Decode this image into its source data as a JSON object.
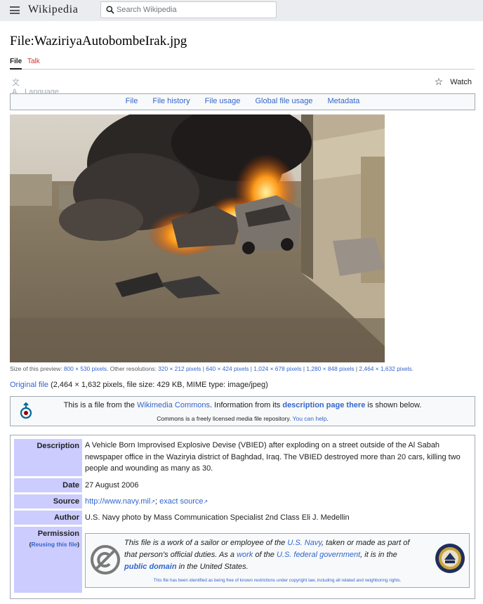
{
  "header": {
    "wordmark": "Wikipedia",
    "search_placeholder": "Search Wikipedia"
  },
  "page": {
    "title": "File:WaziriyaAutobombeIrak.jpg",
    "tabs": [
      {
        "label": "File",
        "active": true
      },
      {
        "label": "Talk",
        "active": false
      }
    ],
    "language_label": "Language",
    "watch_label": "Watch"
  },
  "filetoc": [
    "File",
    "File history",
    "File usage",
    "Global file usage",
    "Metadata"
  ],
  "preview": {
    "size_label": "Size of this preview:",
    "size_value": "800 × 530 pixels",
    "other_label": ". Other resolutions:",
    "resolutions": [
      "320 × 212 pixels",
      "640 × 424 pixels",
      "1,024 × 678 pixels",
      "1,280 × 848 pixels",
      "2,464 × 1,632 pixels"
    ],
    "end": "."
  },
  "original": {
    "link": "Original file",
    "details": " (2,464 × 1,632 pixels, file size: 429 KB, MIME type: image/jpeg)"
  },
  "commons": {
    "line1_a": "This is a file from the ",
    "line1_link": "Wikimedia Commons",
    "line1_b": ". Information from its ",
    "line1_bold_link": "description page there",
    "line1_c": " is shown below.",
    "line2_a": "Commons is a freely licensed media file repository. ",
    "line2_link": "You can help",
    "line2_b": "."
  },
  "info": {
    "description_label": "Description",
    "description_value": "A Vehicle Born Improvised Explosive Devise (VBIED) after exploding on a street outside of the Al Sabah newspaper office in the Waziryia district of Baghdad, Iraq. The VBIED destroyed more than 20 cars, killing two people and wounding as many as 30.",
    "date_label": "Date",
    "date_value": "27 August 2006",
    "source_label": "Source",
    "source_link1": "http://www.navy.mil",
    "source_sep": "; ",
    "source_link2": "exact source",
    "author_label": "Author",
    "author_value": "U.S. Navy photo by Mass Communication Specialist 2nd Class Eli J. Medellin",
    "permission_label": "Permission",
    "reuse_open": "(",
    "reuse_link": "Reusing this file",
    "reuse_close": ")"
  },
  "permission": {
    "t1": "This file is a work of a sailor or employee of the ",
    "l1": "U.S. Navy",
    "t2": ", taken or made as part of that person's official duties. As a ",
    "l2": "work",
    "t3": " of the ",
    "l3": "U.S. federal government",
    "t4": ", it is in the ",
    "l4": "public domain",
    "t5": " in the United States.",
    "note": "This file has been identified as being free of known restrictions under copyright law, including all related and neighboring rights."
  },
  "colors": {
    "link": "#3366cc",
    "header_bg": "#eaecf0",
    "label_bg": "#ccccff",
    "talk": "#d73333"
  }
}
